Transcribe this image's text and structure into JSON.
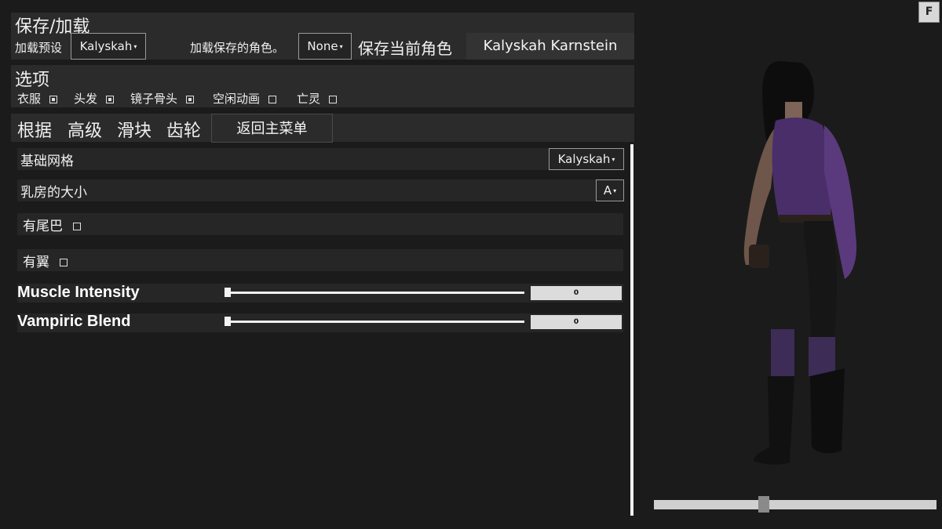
{
  "save_load": {
    "title": "保存/加载",
    "preset_label": "加载预设",
    "preset_value": "Kalyskah",
    "load_saved_label": "加载保存的角色。",
    "load_saved_value": "None",
    "save_current_label": "保存当前角色",
    "save_button_label": "Kalyskah Karnstein"
  },
  "options": {
    "title": "选项",
    "items": [
      {
        "label": "衣服",
        "checked": true
      },
      {
        "label": "头发",
        "checked": true
      },
      {
        "label": "镜子骨头",
        "checked": true
      },
      {
        "label": "空闲动画",
        "checked": false
      },
      {
        "label": "亡灵",
        "checked": false
      }
    ]
  },
  "tabs": {
    "items": [
      "根据",
      "高级",
      "滑块",
      "齿轮"
    ],
    "back_button": "返回主菜单"
  },
  "settings": {
    "base_mesh": {
      "label": "基础网格",
      "value": "Kalyskah"
    },
    "breast_size": {
      "label": "乳房的大小",
      "value": "A"
    },
    "has_tail": {
      "label": "有尾巴",
      "checked": false
    },
    "has_wings": {
      "label": "有翼",
      "checked": false
    }
  },
  "sliders": [
    {
      "label": "Muscle Intensity",
      "value": 0,
      "display": "0"
    },
    {
      "label": "Vampiric Blend",
      "value": 0,
      "display": "0"
    }
  ],
  "corner_button": "F",
  "rotate_slider": {
    "value": 0.24
  },
  "colors": {
    "panel": "#2b2b2b",
    "background": "#1b1b1b",
    "outfit_purple": "#4a2e6a"
  }
}
